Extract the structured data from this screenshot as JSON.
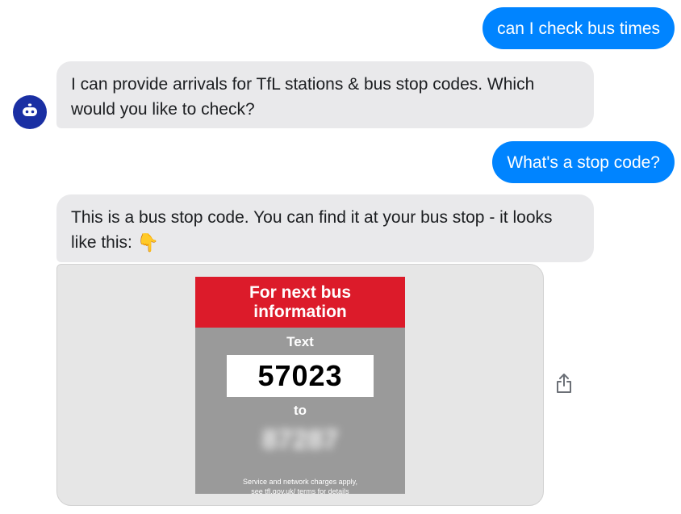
{
  "messages": {
    "user_1": "can I check bus times",
    "bot_1": "I can provide arrivals for TfL stations & bus stop codes. Which would you like to check?",
    "user_2": "What's a stop code?",
    "bot_2": "This is a bus stop code. You can find it at your bus stop - it looks like this:",
    "bot_2_emoji": "👇"
  },
  "bot_avatar": {
    "icon": "robot-icon",
    "color": "#1a2fa3"
  },
  "stop_sign": {
    "header": "For next bus\ninformation",
    "text_label": "Text",
    "stop_code": "57023",
    "to_label": "to",
    "sms_number": "87287",
    "footer": "Service and network charges apply,\nsee tfl.gov.uk/ terms for details"
  },
  "actions": {
    "share_icon": "share-icon"
  },
  "colors": {
    "outgoing_bubble": "#0084ff",
    "incoming_bubble": "#e9e9eb",
    "sign_red": "#dc1b2a",
    "sign_grey": "#9a9a9a"
  }
}
